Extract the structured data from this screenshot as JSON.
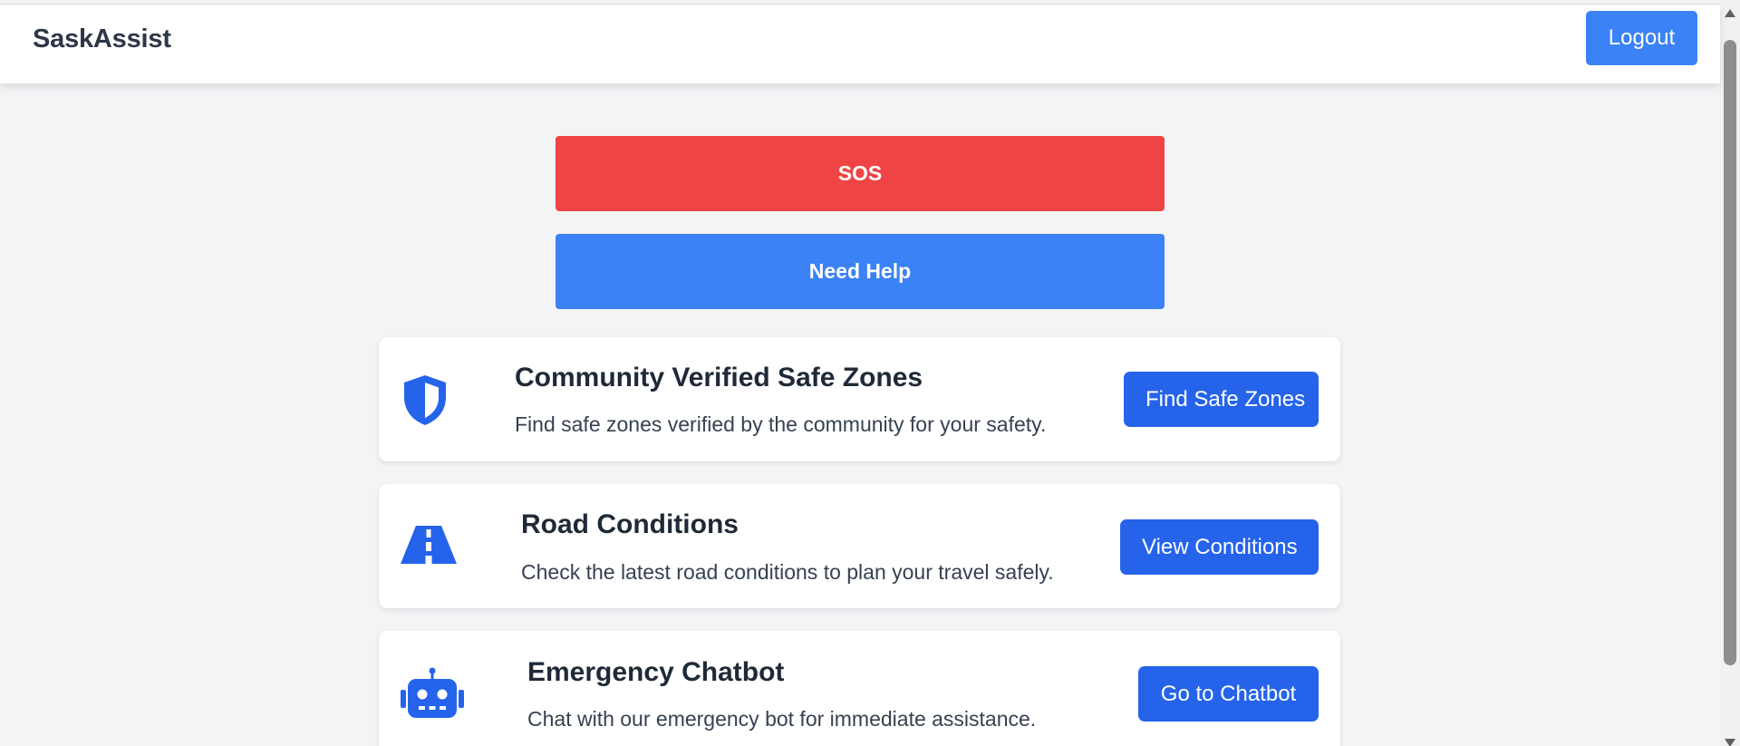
{
  "header": {
    "brand": "SaskAssist",
    "logout_label": "Logout"
  },
  "actions": {
    "sos_label": "SOS",
    "help_label": "Need Help"
  },
  "cards": [
    {
      "icon": "shield-icon",
      "title": "Community Verified Safe Zones",
      "description": "Find safe zones verified by the community for your safety.",
      "button_label": "Find Safe Zones"
    },
    {
      "icon": "road-icon",
      "title": "Road Conditions",
      "description": "Check the latest road conditions to plan your travel safely.",
      "button_label": "View Conditions"
    },
    {
      "icon": "robot-icon",
      "title": "Emergency Chatbot",
      "description": "Chat with our emergency bot for immediate assistance.",
      "button_label": "Go to Chatbot"
    }
  ],
  "colors": {
    "background": "#f3f4f6",
    "sos": "#ef4444",
    "help": "#3b82f6",
    "primary": "#2563eb",
    "brand_text": "#2d3748"
  }
}
